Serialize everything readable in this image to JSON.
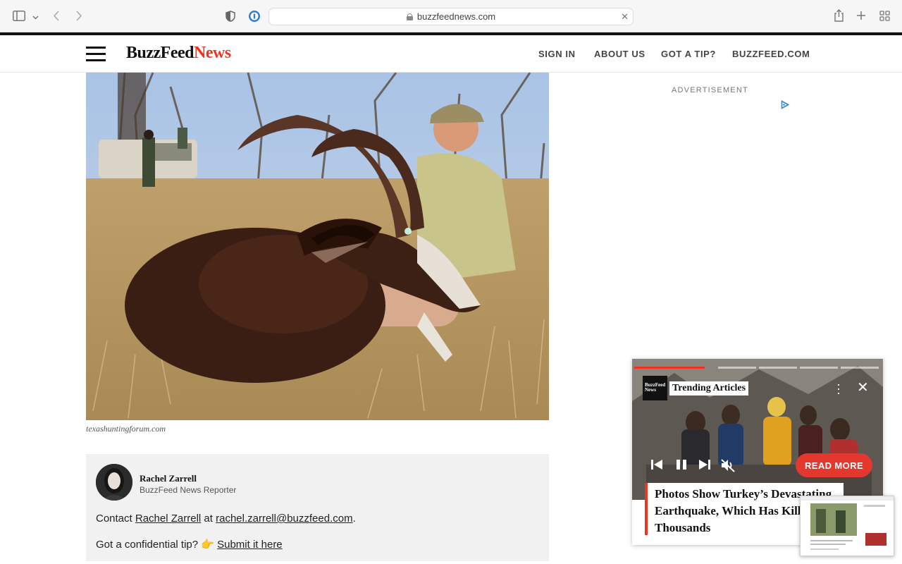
{
  "browser": {
    "url": "buzzfeednews.com",
    "icons": [
      "sidebar-icon",
      "chevron-down-icon",
      "back-icon",
      "forward-icon",
      "shield-icon",
      "password-icon",
      "share-icon",
      "plus-icon",
      "tabs-grid-icon"
    ]
  },
  "header": {
    "logo_part1": "BuzzFeed",
    "logo_part2": "News",
    "nav": [
      "SIGN IN",
      "ABOUT US",
      "GOT A TIP?",
      "BUZZFEED.COM"
    ]
  },
  "article": {
    "image_caption": "texashuntingforum.com"
  },
  "author": {
    "name": "Rachel Zarrell",
    "role": "BuzzFeed News Reporter",
    "contact_prefix": "Contact",
    "contact_name": "Rachel Zarrell",
    "contact_at": "at",
    "email": "rachel.zarrell@buzzfeed.com",
    "contact_suffix": ".",
    "tip_prefix": "Got a confidential tip? 👉",
    "tip_link": "Submit it here"
  },
  "sidebar": {
    "ad_label": "ADVERTISEMENT"
  },
  "video_widget": {
    "logo_line1": "BuzzFeed",
    "logo_line2": "News",
    "title": "Trending Articles",
    "read_more": "READ MORE",
    "headline": "Photos Show Turkey’s Devastating Earthquake, Which Has Killed Thousands",
    "accent_color": "#e4372d"
  },
  "colors": {
    "brand_red": "#e32222",
    "text_dark": "#111111"
  }
}
